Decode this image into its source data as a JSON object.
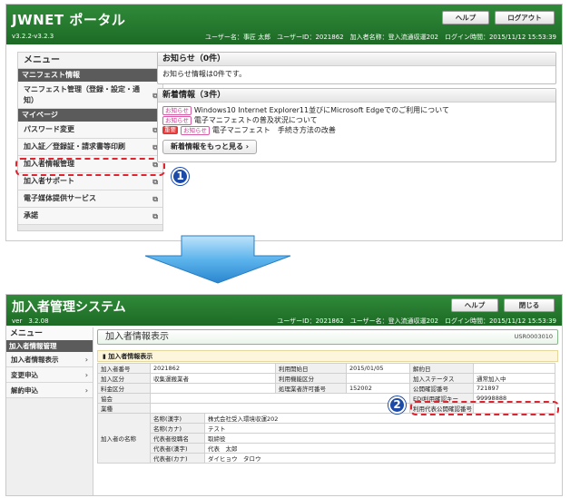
{
  "top": {
    "header": {
      "logo": "JWNET ポータル",
      "version": "v3.2.2-v3.2.3",
      "user_info": "ユーザー名：事匠 太郎　ユーザーID：2021862　加入者名称：登入流通収運202　ログイン時間：2015/11/12 15:53:39",
      "help_label": "ヘルプ",
      "logout_label": "ログアウト"
    },
    "sidebar": {
      "menu_title": "メニュー",
      "section1": "マニフェスト情報",
      "item_manifest": "マニフェスト管理（登録・設定・通知）",
      "section2": "マイページ",
      "item_password": "パスワード変更",
      "item_certificate": "加入証／登録証・請求書等印刷",
      "item_member_info": "加入者情報管理",
      "item_support": "加入者サポート",
      "item_media": "電子媒体提供サービス",
      "item_approval": "承諾"
    },
    "notice": {
      "title": "お知らせ（0件）",
      "body": "お知らせ情報は0件です。"
    },
    "news": {
      "title": "新着情報（3件）",
      "items": [
        {
          "badge": "お知らせ",
          "text": "Windows10 Internet Explorer11並びにMicrosoft Edgeでのご利用について"
        },
        {
          "badge": "お知らせ",
          "text": "電子マニフェストの普及状況について"
        },
        {
          "badge_important": "重要",
          "badge": "お知らせ",
          "text": "電子マニフェスト　手続き方法の改善"
        }
      ],
      "more_label": "新着情報をもっと見る ›"
    },
    "step_number": "1"
  },
  "bottom": {
    "header": {
      "logo": "加入者管理システム",
      "version": "ver　3.2.08",
      "user_info": "ユーザーID：2021862　ユーザー名：登入流通収運202　ログイン時間：2015/11/12 15:53:39",
      "help_label": "ヘルプ",
      "close_label": "閉じる"
    },
    "sidebar": {
      "menu_title": "メニュー",
      "section": "加入者情報管理",
      "item_display": "加入者情報表示",
      "item_change": "変更申込",
      "item_cancel": "解約申込"
    },
    "screen": {
      "title": "加入者情報表示",
      "screen_id": "USR0003010",
      "subtitle": "加入者情報表示"
    },
    "table": {
      "r1": [
        "加入者番号",
        "2021862",
        "利用開始日",
        "2015/01/05",
        "解約日",
        ""
      ],
      "r2": [
        "加入区分",
        "収集運搬業者",
        "利用機能区分",
        "",
        "加入ステータス",
        "通常加入中"
      ],
      "r3": [
        "料金区分",
        "",
        "処理業者許可番号",
        "152002",
        "公開確認番号",
        "721897"
      ],
      "r4": [
        "協会",
        "",
        "",
        "",
        "EDI利用確認キー",
        "99998888"
      ],
      "r5": [
        "業種",
        "",
        "",
        "",
        "利用代表公開確認番号",
        ""
      ],
      "name_label": "加入者の名称",
      "name_rows": [
        [
          "名称(漢字)",
          "株式会社受入環境収運202"
        ],
        [
          "名称(カナ)",
          "テスト"
        ],
        [
          "代表者役職名",
          "取締役"
        ],
        [
          "代表者(漢字)",
          "代表　太郎"
        ],
        [
          "代表者(カナ)",
          "ダイヒョウ　タロウ"
        ]
      ]
    },
    "step_number": "2"
  },
  "colors": {
    "header_green": "#1d6a25",
    "highlight_red": "#e0242f",
    "number_blue": "#1b4aa8",
    "arrow_blue": "#3a9fe0"
  }
}
